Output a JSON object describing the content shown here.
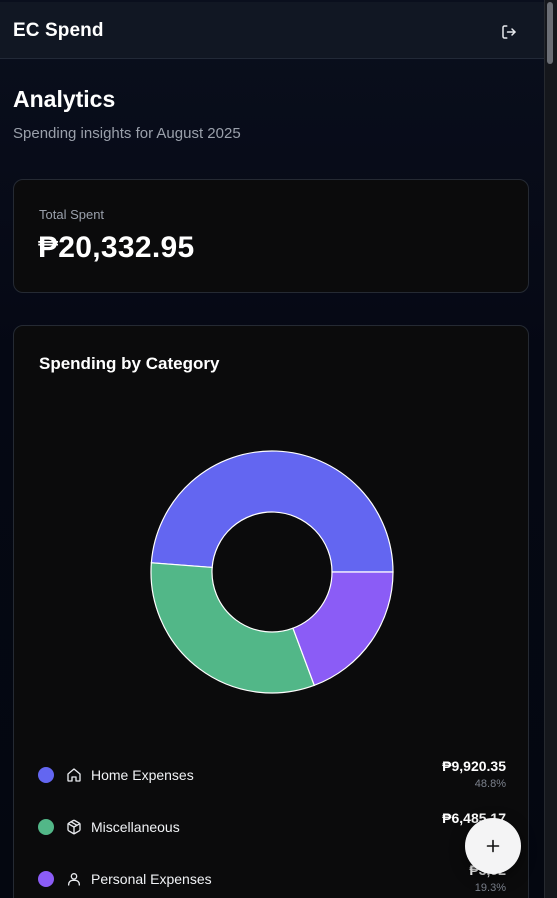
{
  "header": {
    "app_title": "EC Spend",
    "logout_icon": "logout-icon"
  },
  "page": {
    "title": "Analytics",
    "subtitle": "Spending insights for August 2025"
  },
  "total": {
    "label": "Total Spent",
    "value": "₱20,332.95"
  },
  "category_card": {
    "title": "Spending by Category"
  },
  "chart_data": {
    "type": "pie",
    "title": "Spending by Category",
    "categories": [
      "Home Expenses",
      "Miscellaneous",
      "Personal Expenses"
    ],
    "values": [
      9920.35,
      6485.17,
      3927.43
    ],
    "percentages": [
      48.8,
      31.9,
      19.3
    ],
    "colors": [
      "#6366f1",
      "#52b788",
      "#8b5cf6"
    ],
    "donut": true
  },
  "legend": [
    {
      "name": "Home Expenses",
      "amount": "₱9,920.35",
      "percent": "48.8%",
      "color": "#6366f1",
      "icon": "home-icon"
    },
    {
      "name": "Miscellaneous",
      "amount": "₱6,485.17",
      "percent": "",
      "color": "#52b788",
      "icon": "package-icon"
    },
    {
      "name": "Personal Expenses",
      "amount": "₱3,92",
      "percent": "19.3%",
      "color": "#8b5cf6",
      "icon": "user-icon"
    }
  ],
  "fab": {
    "label": "+",
    "icon": "plus-icon"
  },
  "colors": {
    "background": "#050810",
    "card": "#0b0b0c",
    "border": "#252a33",
    "muted_text": "#9aa0ab"
  }
}
